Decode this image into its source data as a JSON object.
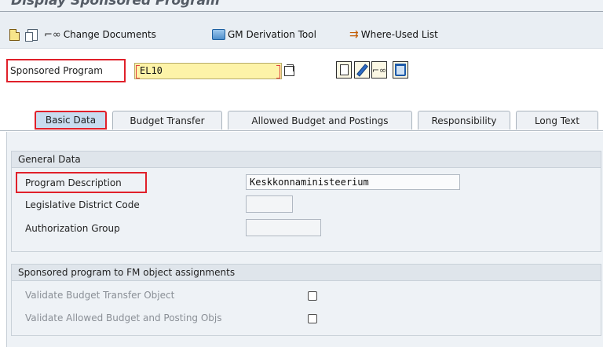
{
  "window": {
    "title": "Display Sponsored Program"
  },
  "toolbar": {
    "change_documents_label": "Change Documents",
    "gm_derivation_label": "GM Derivation Tool",
    "where_used_label": "Where-Used List"
  },
  "header": {
    "sponsored_program_label": "Sponsored Program",
    "sponsored_program_value": "EL10"
  },
  "tabs": [
    {
      "label": "Basic Data",
      "active": true
    },
    {
      "label": "Budget Transfer",
      "active": false
    },
    {
      "label": "Allowed Budget and Postings",
      "active": false
    },
    {
      "label": "Responsibility",
      "active": false
    },
    {
      "label": "Long Text",
      "active": false
    }
  ],
  "general_data": {
    "heading": "General Data",
    "program_description_label": "Program Description",
    "program_description_value": "Keskkonnaministeerium",
    "legislative_district_label": "Legislative District Code",
    "legislative_district_value": "",
    "authorization_group_label": "Authorization Group",
    "authorization_group_value": ""
  },
  "assignments": {
    "heading": "Sponsored program to FM object assignments",
    "validate_budget_transfer_label": "Validate Budget Transfer Object",
    "validate_budget_transfer_checked": false,
    "validate_allowed_budget_label": "Validate Allowed Budget and Posting Objs",
    "validate_allowed_budget_checked": false
  },
  "colors": {
    "highlight": "#e0202a",
    "required_field": "#fdf3a8",
    "panel": "#eef2f6",
    "active_tab": "#c8dcef"
  }
}
